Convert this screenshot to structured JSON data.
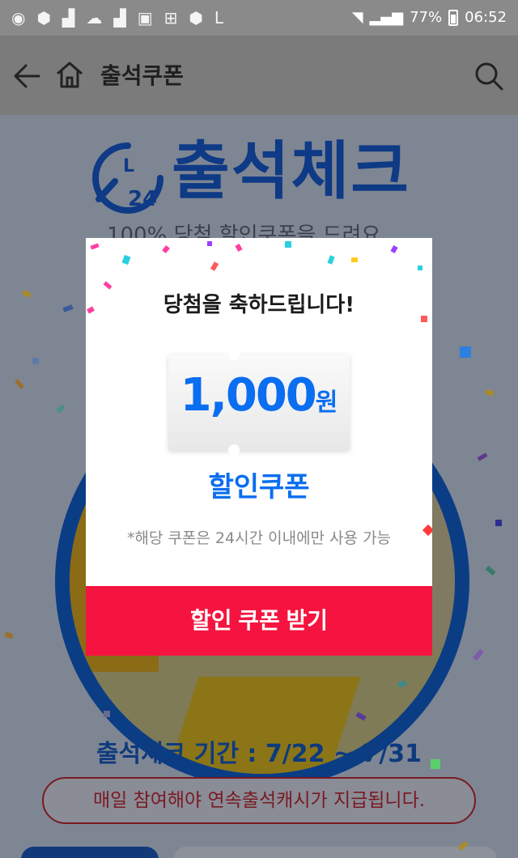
{
  "status_bar": {
    "battery": "77%",
    "time": "06:52"
  },
  "header": {
    "title": "출석쿠폰"
  },
  "page": {
    "logo_text": "24",
    "logo_letter": "L",
    "title": "출석체크",
    "subtitle": "100% 당첨 할인쿠폰을 드려요",
    "period": "출석체크 기간 : 7/22 ~ 7/31",
    "notice": "매일 참여해야 연속출석캐시가 지급됩니다."
  },
  "modal": {
    "heading": "당첨을 축하드립니다!",
    "coupon_amount": "1,000",
    "coupon_unit": "원",
    "coupon_label": "할인쿠폰",
    "note": "*해당 쿠폰은 24시간 이내에만 사용 가능",
    "button_label": "할인 쿠폰 받기"
  },
  "colors": {
    "accent_blue": "#0a6ef0",
    "button_red": "#f5143f",
    "navy": "#0e3a86"
  }
}
